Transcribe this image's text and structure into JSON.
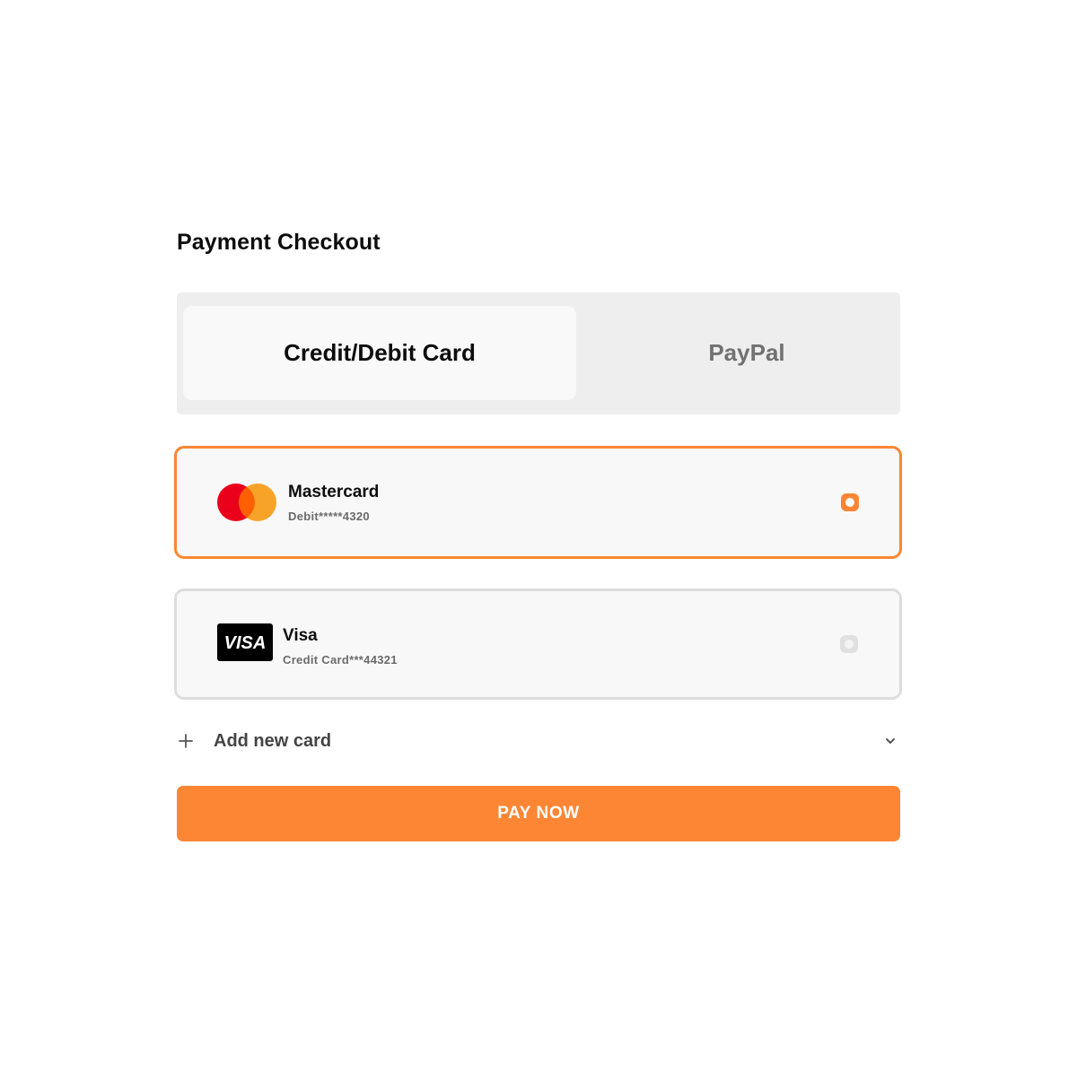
{
  "page": {
    "title": "Payment Checkout"
  },
  "tabs": [
    {
      "label": "Credit/Debit Card",
      "active": true
    },
    {
      "label": "PayPal",
      "active": false
    }
  ],
  "cards": [
    {
      "brand": "Mastercard",
      "detail": "Debit*****4320",
      "icon": "mastercard-logo-icon",
      "selected": true
    },
    {
      "brand": "Visa",
      "detail": "Credit Card***44321",
      "icon": "visa-logo-icon",
      "logo_text": "VISA",
      "selected": false
    }
  ],
  "add_card": {
    "label": "Add new card",
    "icon": "plus-icon",
    "expand_icon": "chevron-down-icon"
  },
  "pay_button": {
    "label": "PAY NOW"
  },
  "colors": {
    "accent": "#fd8634",
    "mastercard_red": "#eb001b",
    "mastercard_orange": "#f79e1b",
    "visa_bg": "#000000"
  }
}
